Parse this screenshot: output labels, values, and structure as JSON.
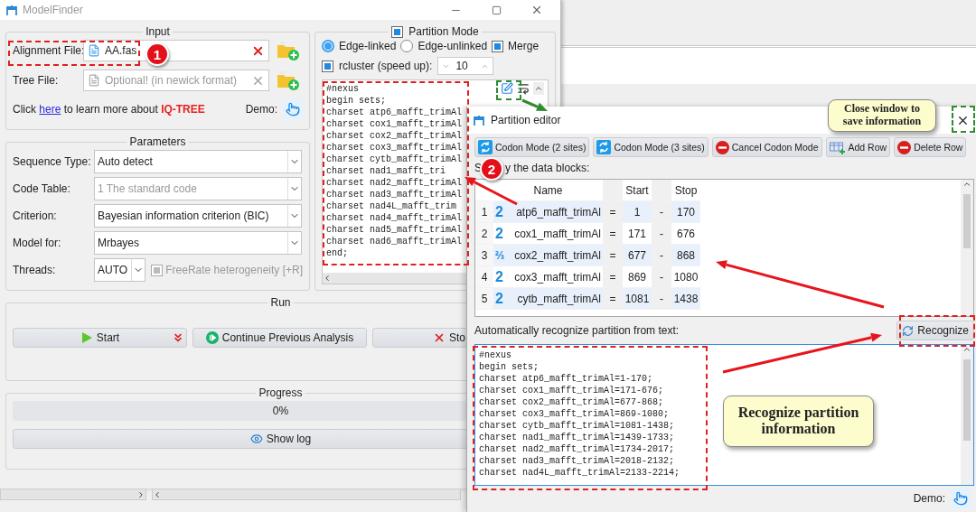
{
  "main_window": {
    "title": "ModelFinder",
    "input": {
      "legend": "Input",
      "alignment": {
        "label": "Alignment File:",
        "value": "AA.fas"
      },
      "tree": {
        "label": "Tree File:",
        "placeholder": "Optional! (in newick format)"
      },
      "help": {
        "prefix": "Click",
        "link": "here",
        "middle": "to learn more about",
        "brand": "IQ-TREE"
      },
      "demo": "Demo:"
    },
    "parameters": {
      "legend": "Parameters",
      "fields": [
        {
          "label": "Sequence Type:",
          "value": "Auto detect",
          "disabled": false
        },
        {
          "label": "Code Table:",
          "value": "1 The standard code",
          "disabled": true
        },
        {
          "label": "Criterion:",
          "value": "Bayesian information criterion (BIC)",
          "disabled": false
        },
        {
          "label": "Model for:",
          "value": "Mrbayes",
          "disabled": false
        }
      ],
      "threads": {
        "label": "Threads:",
        "value": "AUTO"
      },
      "freerate": {
        "label": "FreeRate heterogeneity [+R]",
        "checked": true,
        "disabled": true
      }
    },
    "partition": {
      "legend": "Partition Mode",
      "checked": true,
      "modes": [
        {
          "label": "Edge-linked",
          "selected": true
        },
        {
          "label": "Edge-unlinked",
          "selected": false
        }
      ],
      "merge": {
        "label": "Merge",
        "checked": true
      },
      "rcluster": {
        "label": "rcluster (speed up):",
        "checked": true,
        "value": "10"
      },
      "text_lines": [
        "#nexus",
        "begin sets;",
        "charset atp6_mafft_trimAl",
        "charset cox1_mafft_trimAl",
        "charset cox2_mafft_trimAl",
        "charset cox3_mafft_trimAl",
        "charset cytb_mafft_trimAl",
        "charset nad1_mafft_tri",
        "charset nad2_mafft_trimAl",
        "charset nad3_mafft_trimAl",
        "charset nad4L_mafft_trim",
        "charset nad4_mafft_trimAl",
        "charset nad5_mafft_trimAl",
        "charset nad6_mafft_trimAl",
        "end;"
      ]
    },
    "run": {
      "legend": "Run",
      "buttons": [
        {
          "kind": "start",
          "label": "Start"
        },
        {
          "kind": "continue",
          "label": "Continue Previous Analysis"
        },
        {
          "kind": "stop",
          "label": "Sto"
        }
      ]
    },
    "progress": {
      "legend": "Progress",
      "level": 0,
      "reading": "0%",
      "log_button": "Show log"
    }
  },
  "editor": {
    "title": "Partition editor",
    "toolbar": [
      {
        "kind": "codon",
        "label": "Codon Mode (2 sites)"
      },
      {
        "kind": "codon",
        "label": "Codon Mode (3 sites)"
      },
      {
        "kind": "cancel",
        "label": "Cancel Codon Mode"
      },
      {
        "kind": "add",
        "label": "Add Row"
      },
      {
        "kind": "delete",
        "label": "Delete Row"
      }
    ],
    "blocks_label_start": "S",
    "blocks_label_end": "y the data blocks:",
    "columns": [
      "Name",
      "Start",
      "Stop"
    ],
    "rows": [
      {
        "index": "1",
        "codon": "2",
        "name": "atp6_mafft_trimAl",
        "eq": "=",
        "start": "1",
        "dash": "-",
        "stop": "170"
      },
      {
        "index": "2",
        "codon": "2",
        "name": "cox1_mafft_trimAl",
        "eq": "=",
        "start": "171",
        "dash": "-",
        "stop": "676"
      },
      {
        "index": "3",
        "codon": "⅔",
        "name": "cox2_mafft_trimAl",
        "eq": "=",
        "start": "677",
        "dash": "-",
        "stop": "868"
      },
      {
        "index": "4",
        "codon": "2",
        "name": "cox3_mafft_trimAl",
        "eq": "=",
        "start": "869",
        "dash": "-",
        "stop": "1080"
      },
      {
        "index": "5",
        "codon": "2",
        "name": "cytb_mafft_trimAl",
        "eq": "=",
        "start": "1081",
        "dash": "-",
        "stop": "1438"
      }
    ],
    "recognize_label": "Automatically recognize partition from text:",
    "recognize_button": "Recognize",
    "text_lines": [
      "#nexus",
      "begin sets;",
      "charset atp6_mafft_trimAl=1-170;",
      "charset cox1_mafft_trimAl=171-676;",
      "charset cox2_mafft_trimAl=677-868;",
      "charset cox3_mafft_trimAl=869-1080;",
      "charset cytb_mafft_trimAl=1081-1438;",
      "charset nad1_mafft_trimAl=1439-1733;",
      "charset nad2_mafft_trimAl=1734-2017;",
      "charset nad3_mafft_trimAl=2018-2132;",
      "charset nad4L_mafft_trimAl=2133-2214;"
    ],
    "demo": "Demo:"
  },
  "annotations": {
    "badges": [
      "1",
      "2"
    ],
    "callouts": [
      "Close window to save information",
      "Recognize partition information"
    ]
  }
}
